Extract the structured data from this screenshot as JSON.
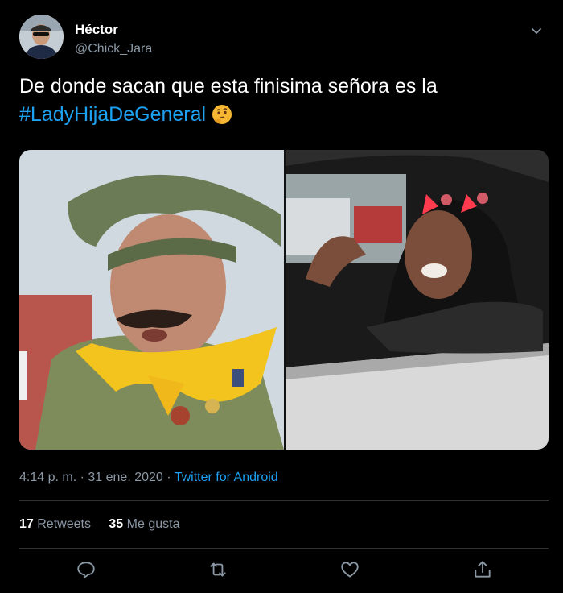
{
  "author": {
    "name": "Héctor",
    "handle": "@Chick_Jara"
  },
  "tweet": {
    "text": "De donde sacan que esta finisima señora es la",
    "hashtag": "#LadyHijaDeGeneral",
    "emoji": "thinking-face"
  },
  "meta": {
    "time": "4:14 p. m.",
    "separator": " · ",
    "date": "31 ene. 2020",
    "source": "Twitter for Android"
  },
  "stats": {
    "retweets_count": "17",
    "retweets_label": "Retweets",
    "likes_count": "35",
    "likes_label": "Me gusta"
  },
  "actions": [
    "reply-icon",
    "retweet-icon",
    "like-icon",
    "share-icon"
  ],
  "colors": {
    "background": "#000000",
    "accent": "#1da1f2",
    "secondary_text": "#8b98a5",
    "divider": "#2f3336"
  }
}
